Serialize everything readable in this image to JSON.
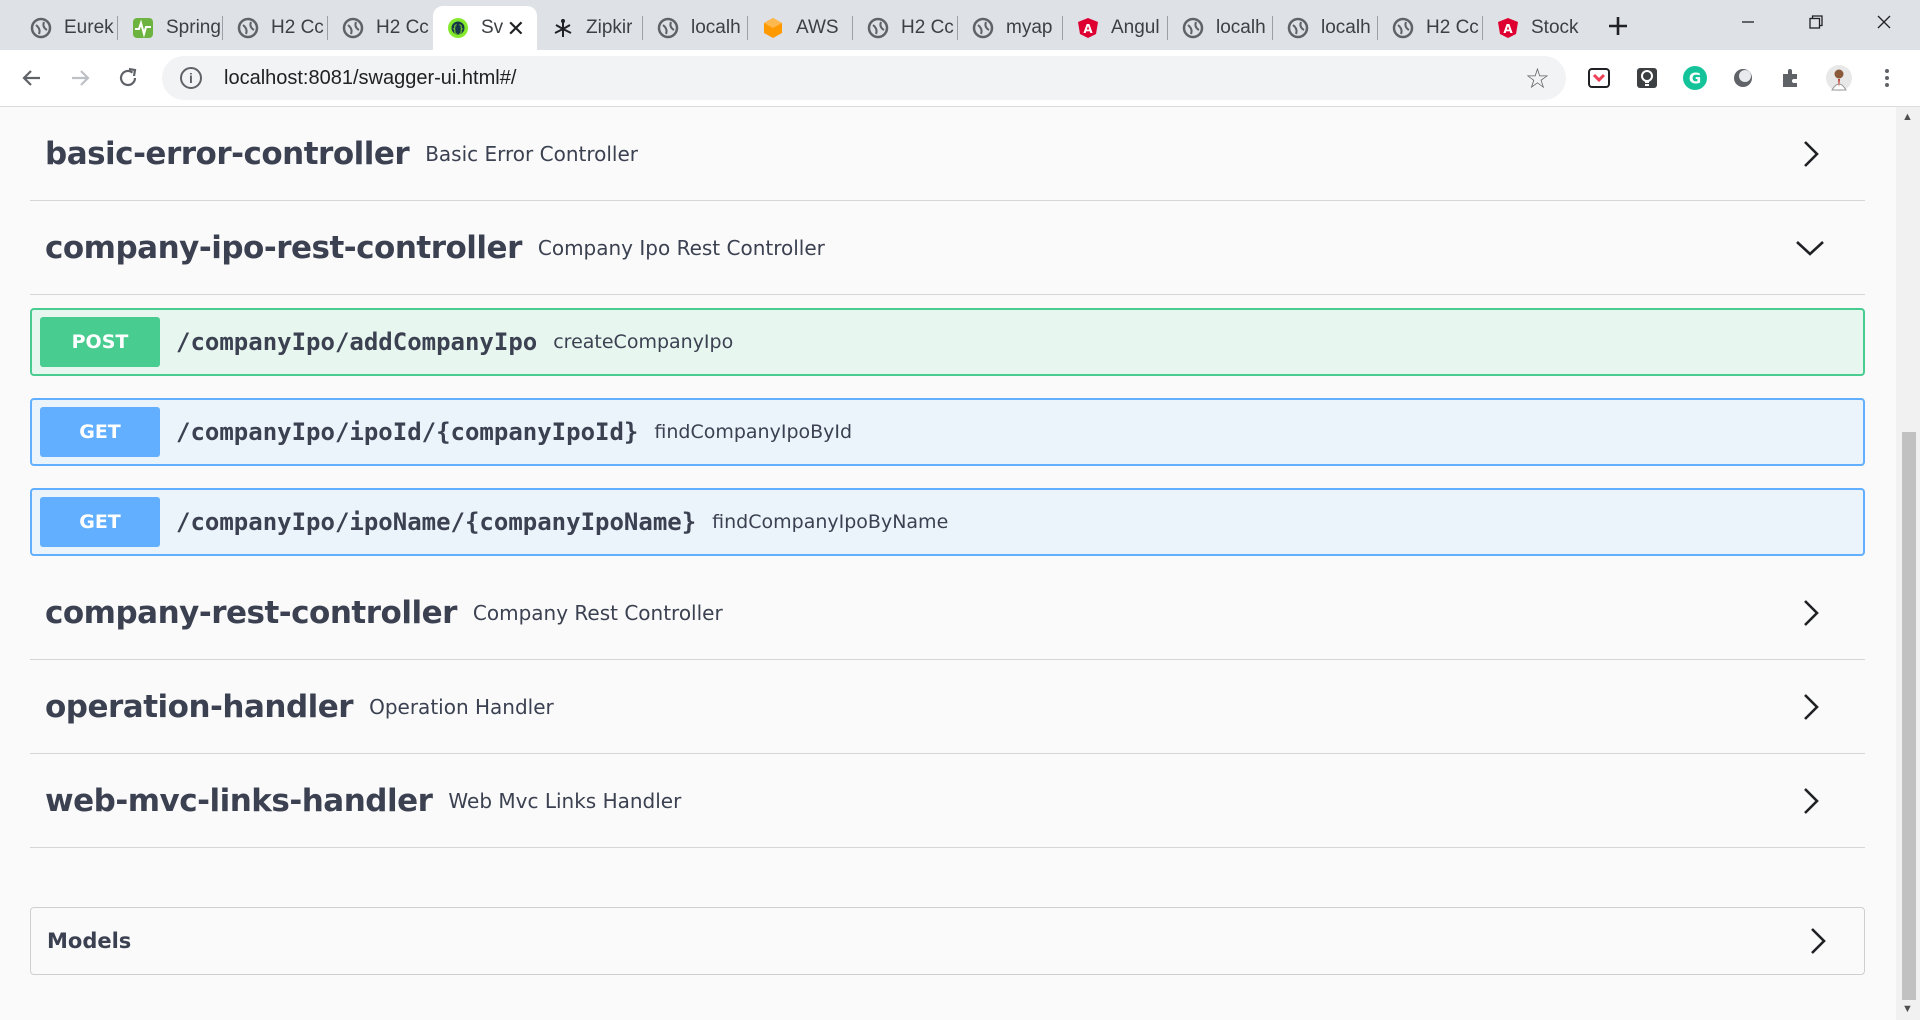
{
  "browser": {
    "tabs": [
      {
        "label": "Eurek",
        "icon": "globe-icon"
      },
      {
        "label": "Spring",
        "icon": "spring-pulse-icon"
      },
      {
        "label": "H2 Cc",
        "icon": "globe-icon"
      },
      {
        "label": "H2 Cc",
        "icon": "globe-icon"
      },
      {
        "label": "Sv",
        "icon": "swagger-icon",
        "active": true
      },
      {
        "label": "Zipkir",
        "icon": "zipkin-icon"
      },
      {
        "label": "localh",
        "icon": "globe-icon"
      },
      {
        "label": "AWS",
        "icon": "aws-icon"
      },
      {
        "label": "H2 Cc",
        "icon": "globe-icon"
      },
      {
        "label": "myap",
        "icon": "globe-icon"
      },
      {
        "label": "Angul",
        "icon": "angular-icon"
      },
      {
        "label": "localh",
        "icon": "globe-icon"
      },
      {
        "label": "localh",
        "icon": "globe-icon"
      },
      {
        "label": "H2 Cc",
        "icon": "globe-icon"
      },
      {
        "label": "Stock",
        "icon": "angular-icon"
      }
    ],
    "url": "localhost:8081/swagger-ui.html#/"
  },
  "sections": [
    {
      "name": "basic-error-controller",
      "description": "Basic Error Controller",
      "expanded": false
    },
    {
      "name": "company-ipo-rest-controller",
      "description": "Company Ipo Rest Controller",
      "expanded": true
    },
    {
      "name": "company-rest-controller",
      "description": "Company Rest Controller",
      "expanded": false
    },
    {
      "name": "operation-handler",
      "description": "Operation Handler",
      "expanded": false
    },
    {
      "name": "web-mvc-links-handler",
      "description": "Web Mvc Links Handler",
      "expanded": false
    }
  ],
  "operations": [
    {
      "method": "POST",
      "path": "/companyIpo/addCompanyIpo",
      "summary": "createCompanyIpo"
    },
    {
      "method": "GET",
      "path": "/companyIpo/ipoId/{companyIpoId}",
      "summary": "findCompanyIpoById"
    },
    {
      "method": "GET",
      "path": "/companyIpo/ipoName/{companyIpoName}",
      "summary": "findCompanyIpoByName"
    }
  ],
  "models": {
    "title": "Models"
  },
  "colors": {
    "post": "#49cc90",
    "get": "#61affe",
    "text": "#3b4151"
  }
}
